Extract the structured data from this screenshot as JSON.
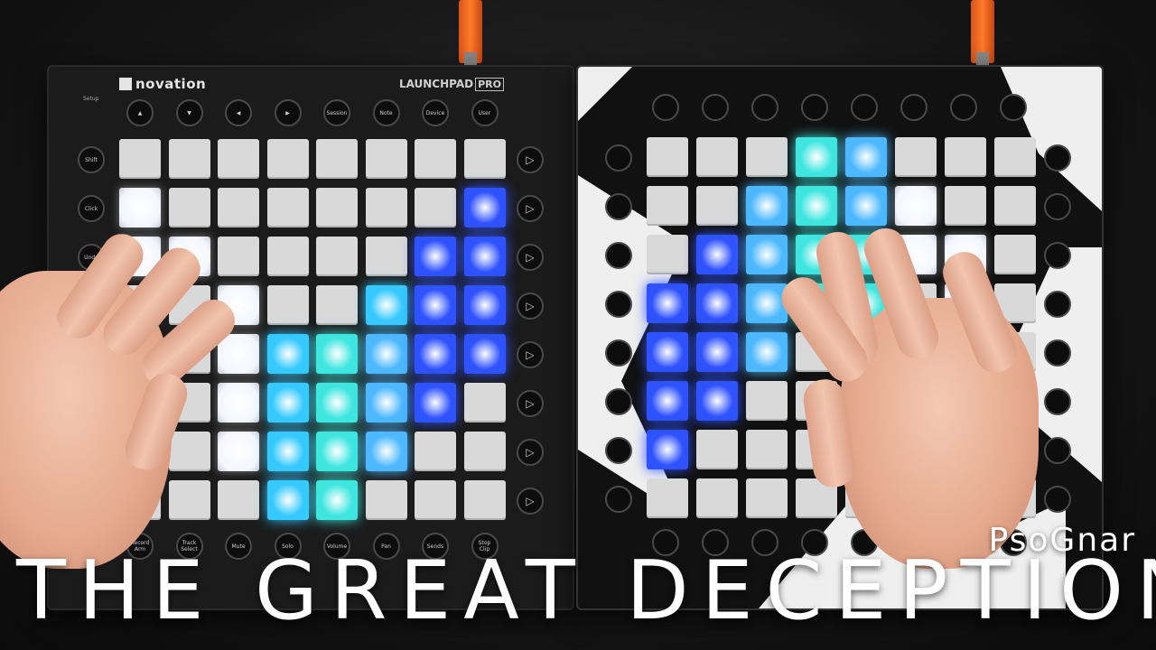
{
  "overlay": {
    "artist": "PsoGnar",
    "title": "THE GREAT DECEPTION"
  },
  "left_device": {
    "brand": "novation",
    "model": "LAUNCHPAD",
    "model_suffix": "PRO",
    "setup_label": "Setup",
    "top_buttons": [
      "▲",
      "▼",
      "◀",
      "▶",
      "Session",
      "Note",
      "Device",
      "User"
    ],
    "side_buttons": [
      "Shift",
      "Click",
      "Undo",
      "",
      "",
      "",
      "",
      ""
    ],
    "bottom_buttons": [
      "Record Arm",
      "Track Select",
      "Mute",
      "Solo",
      "Volume",
      "Pan",
      "Sends",
      "Stop Clip"
    ],
    "right_buttons": [
      "▷",
      "▷",
      "▷",
      "▷",
      "▷",
      "▷",
      "▷",
      "▷"
    ]
  },
  "colors": {
    "pad_off": "#d9d9d9",
    "white_glow": "#f4f6ff",
    "blue": "#2f52ff",
    "cyan": "#36c9ff",
    "teal": "#3fe6e0",
    "sky": "#4db8ff",
    "background": "#141414",
    "cable": "#ff7a2a"
  },
  "left_grid": [
    [
      "o",
      "o",
      "o",
      "o",
      "o",
      "o",
      "o",
      "o"
    ],
    [
      "w",
      "o",
      "o",
      "o",
      "o",
      "o",
      "o",
      "b"
    ],
    [
      "w",
      "w",
      "o",
      "o",
      "o",
      "o",
      "b",
      "b"
    ],
    [
      "o",
      "o",
      "w",
      "o",
      "o",
      "c",
      "b",
      "b"
    ],
    [
      "o",
      "o",
      "w",
      "c",
      "t",
      "s",
      "b",
      "b"
    ],
    [
      "o",
      "o",
      "w",
      "c",
      "t",
      "s",
      "b",
      "o"
    ],
    [
      "o",
      "o",
      "w",
      "c",
      "t",
      "s",
      "o",
      "o"
    ],
    [
      "o",
      "o",
      "o",
      "c",
      "t",
      "o",
      "o",
      "o"
    ]
  ],
  "right_grid": [
    [
      "o",
      "o",
      "o",
      "t",
      "s",
      "o",
      "o",
      "o"
    ],
    [
      "o",
      "o",
      "s",
      "t",
      "s",
      "w",
      "o",
      "o"
    ],
    [
      "o",
      "b",
      "s",
      "t",
      "t",
      "w",
      "w",
      "o"
    ],
    [
      "b",
      "b",
      "s",
      "t",
      "t",
      "o",
      "w",
      "o"
    ],
    [
      "b",
      "b",
      "s",
      "o",
      "o",
      "o",
      "o",
      "o"
    ],
    [
      "b",
      "b",
      "o",
      "o",
      "o",
      "o",
      "o",
      "o"
    ],
    [
      "b",
      "o",
      "o",
      "o",
      "o",
      "o",
      "o",
      "o"
    ],
    [
      "o",
      "o",
      "o",
      "o",
      "o",
      "o",
      "o",
      "o"
    ]
  ]
}
